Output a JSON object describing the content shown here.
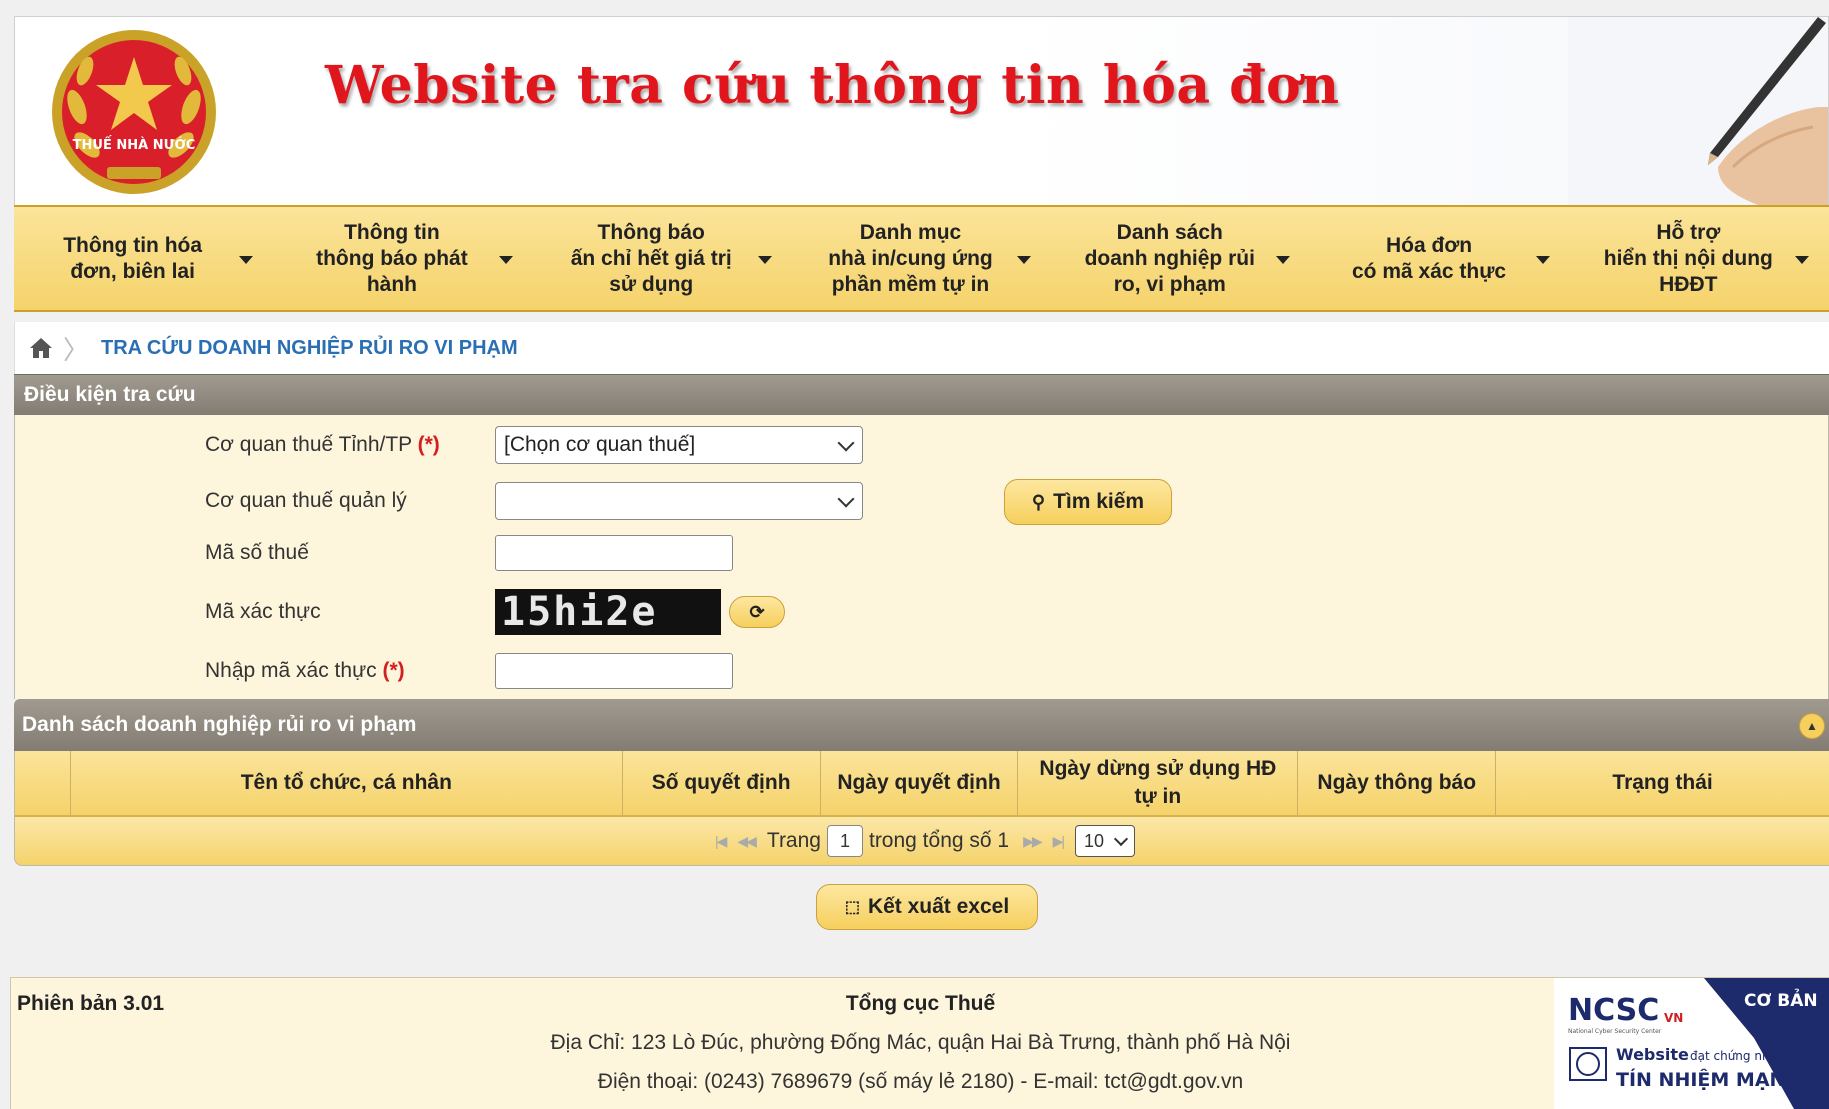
{
  "banner": {
    "title": "Website tra cứu thông tin hóa đơn",
    "emblem_text": "THUẾ NHÀ NƯỚC"
  },
  "menu": [
    {
      "label": "Thông tin hóa\nđơn, biên lai"
    },
    {
      "label": "Thông tin\nthông báo phát\nhành"
    },
    {
      "label": "Thông báo\nấn chỉ hết giá trị\nsử dụng"
    },
    {
      "label": "Danh mục\nnhà in/cung ứng\nphần mềm tự in"
    },
    {
      "label": "Danh sách\ndoanh nghiệp rủi\nro, vi phạm"
    },
    {
      "label": "Hóa đơn\ncó mã xác thực"
    },
    {
      "label": "Hỗ trợ\nhiển thị nội dung\nHĐĐT"
    }
  ],
  "breadcrumb": {
    "current": "TRA CỨU DOANH NGHIỆP RỦI RO VI PHẠM"
  },
  "search": {
    "section_title": "Điều kiện tra cứu",
    "required_mark": "(*)",
    "province_label": "Cơ quan thuế Tỉnh/TP",
    "province_value": "[Chọn cơ quan thuế]",
    "managing_label": "Cơ quan thuế quản lý",
    "managing_value": "",
    "tax_code_label": "Mã số thuế",
    "captcha_label": "Mã xác thực",
    "captcha_text": "15hi2e",
    "captcha_input_label": "Nhập mã xác thực",
    "search_button": "Tìm kiếm"
  },
  "results": {
    "title": "Danh sách doanh nghiệp rủi ro vi phạm",
    "columns": [
      "",
      "Tên tổ chức, cá nhân",
      "Số quyết định",
      "Ngày quyết định",
      "Ngày dừng sử dụng HĐ tự in",
      "Ngày thông báo",
      "Trạng thái"
    ],
    "rows": [],
    "pager": {
      "page_label": "Trang",
      "page_value": "1",
      "total_label": "trong tổng số 1",
      "page_size": "10"
    }
  },
  "export_button": "Kết xuất excel",
  "footer": {
    "version": "Phiên bản 3.01",
    "org": "Tổng cục Thuế",
    "address": "Địa Chỉ: 123 Lò Đúc, phường Đống Mác, quận Hai Bà Trưng, thành phố Hà Nội",
    "phone": "Điện thoại: (0243) 7689679 (số máy lẻ 2180) - E-mail: tct@gdt.gov.vn",
    "badge": {
      "ncsc": "NCSC",
      "vn": "VN",
      "level": "CƠ BẢN",
      "line1": "Website",
      "line1_small": "đạt chứng nhận",
      "line2": "TÍN NHIỆM MẠNG",
      "subtitle": "National Cyber Security Center"
    }
  },
  "colors": {
    "brand_red": "#e0161c",
    "menu_yellow": "#f5d36b",
    "section_gray": "#8f897f",
    "link_blue": "#2a6fb3"
  }
}
